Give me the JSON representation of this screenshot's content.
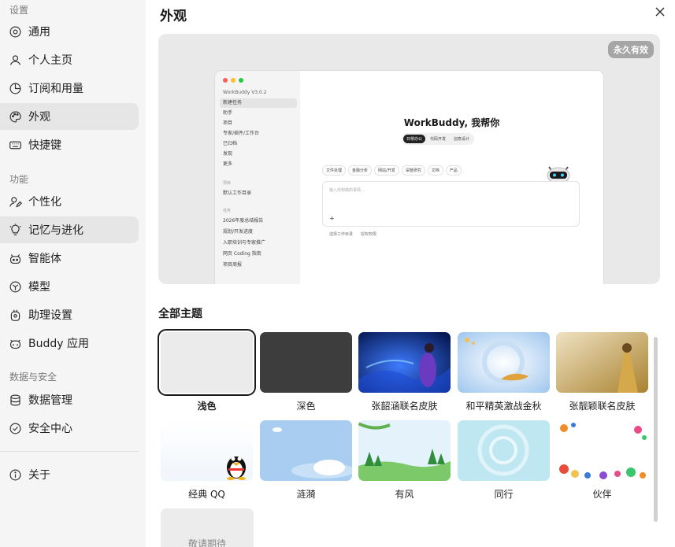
{
  "sidebar": {
    "groups": [
      {
        "label": "设置"
      },
      {
        "label": "功能"
      },
      {
        "label": "数据与安全"
      }
    ],
    "items": [
      {
        "label": "通用",
        "icon": "gear-icon"
      },
      {
        "label": "个人主页",
        "icon": "user-icon"
      },
      {
        "label": "订阅和用量",
        "icon": "pie-chart-icon"
      },
      {
        "label": "外观",
        "icon": "palette-icon",
        "active": true
      },
      {
        "label": "快捷键",
        "icon": "keyboard-icon"
      },
      {
        "label": "个性化",
        "icon": "person-edit-icon"
      },
      {
        "label": "记忆与进化",
        "icon": "lightbulb-icon"
      },
      {
        "label": "智能体",
        "icon": "robot-icon"
      },
      {
        "label": "模型",
        "icon": "model-icon"
      },
      {
        "label": "助理设置",
        "icon": "assistant-icon"
      },
      {
        "label": "Buddy 应用",
        "icon": "buddy-icon"
      },
      {
        "label": "数据管理",
        "icon": "database-icon"
      },
      {
        "label": "安全中心",
        "icon": "shield-check-icon"
      },
      {
        "label": "关于",
        "icon": "info-icon"
      }
    ]
  },
  "main": {
    "title": "外观",
    "badge": "永久有效",
    "section_title": "全部主题",
    "coming_soon": "敬请期待"
  },
  "mini": {
    "version": "WorkBuddy V3.0.2",
    "items": [
      "新建任务",
      "助手",
      "项目",
      "专家/插件/工作台",
      "已归档",
      "发现",
      "更多"
    ],
    "headers": [
      "项目",
      "任务"
    ],
    "project": "默认工作目录",
    "tasks": [
      "2026年度总结报告",
      "规划/开发进度",
      "入职培训与专家推广",
      "网页 Coding 指南",
      "项目周报"
    ],
    "title": "WorkBuddy, 我帮你",
    "tabs": [
      "日常办公",
      "代码开发",
      "创意设计"
    ],
    "chips": [
      "文件处理",
      "金融分析",
      "网站/开发",
      "深度研究",
      "文档",
      "产品"
    ],
    "placeholder": "输入你想做的事情...",
    "bottom": [
      "选择工作目录",
      "授权权限"
    ]
  },
  "themes": [
    {
      "label": "浅色",
      "selected": true
    },
    {
      "label": "深色"
    },
    {
      "label": "张韶涵联名皮肤"
    },
    {
      "label": "和平精英激战金秋"
    },
    {
      "label": "张靓颖联名皮肤"
    },
    {
      "label": "经典 QQ"
    },
    {
      "label": "涟漪"
    },
    {
      "label": "有风"
    },
    {
      "label": "同行"
    },
    {
      "label": "伙伴"
    }
  ],
  "colors": {
    "sidebar_bg": "#f5f5f5",
    "active_bg": "#e6e6e6",
    "dark_theme": "#3d3d3d",
    "light_theme": "#ebebeb"
  }
}
